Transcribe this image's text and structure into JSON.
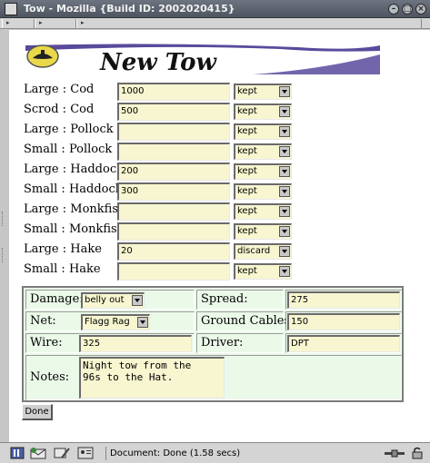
{
  "window": {
    "title": "Tow - Mozilla {Build ID: 2002020415}"
  },
  "page": {
    "heading": "New Tow"
  },
  "fish": [
    {
      "label": "Large : Cod",
      "amount": "1000",
      "status": "kept"
    },
    {
      "label": "Scrod : Cod",
      "amount": "500",
      "status": "kept"
    },
    {
      "label": "Large : Pollock",
      "amount": "",
      "status": "kept"
    },
    {
      "label": "Small : Pollock",
      "amount": "",
      "status": "kept"
    },
    {
      "label": "Large : Haddock",
      "amount": "200",
      "status": "kept"
    },
    {
      "label": "Small : Haddock",
      "amount": "300",
      "status": "kept"
    },
    {
      "label": "Large : Monkfish",
      "amount": "",
      "status": "kept"
    },
    {
      "label": "Small : Monkfish",
      "amount": "",
      "status": "kept"
    },
    {
      "label": "Large : Hake",
      "amount": "20",
      "status": "discard"
    },
    {
      "label": "Small : Hake",
      "amount": "",
      "status": "kept"
    }
  ],
  "details": {
    "damage_label": "Damage:",
    "damage_value": "belly out",
    "spread_label": "Spread:",
    "spread_value": "275",
    "net_label": "Net:",
    "net_value": "Flagg Rag",
    "ground_cables_label": "Ground Cables:",
    "ground_cables_value": "150",
    "wire_label": "Wire:",
    "wire_value": "325",
    "driver_label": "Driver:",
    "driver_value": "DPT",
    "notes_label": "Notes:",
    "notes_value": "Night tow from the\n96s to the Hat."
  },
  "done_label": "Done",
  "statusbar": {
    "text": "Document: Done (1.58 secs)"
  },
  "colors": {
    "field_bg": "#f7f6d0",
    "details_bg": "#ebf9e9",
    "banner_purple": "#5a4a9c",
    "logo_yellow": "#e8d84a"
  }
}
